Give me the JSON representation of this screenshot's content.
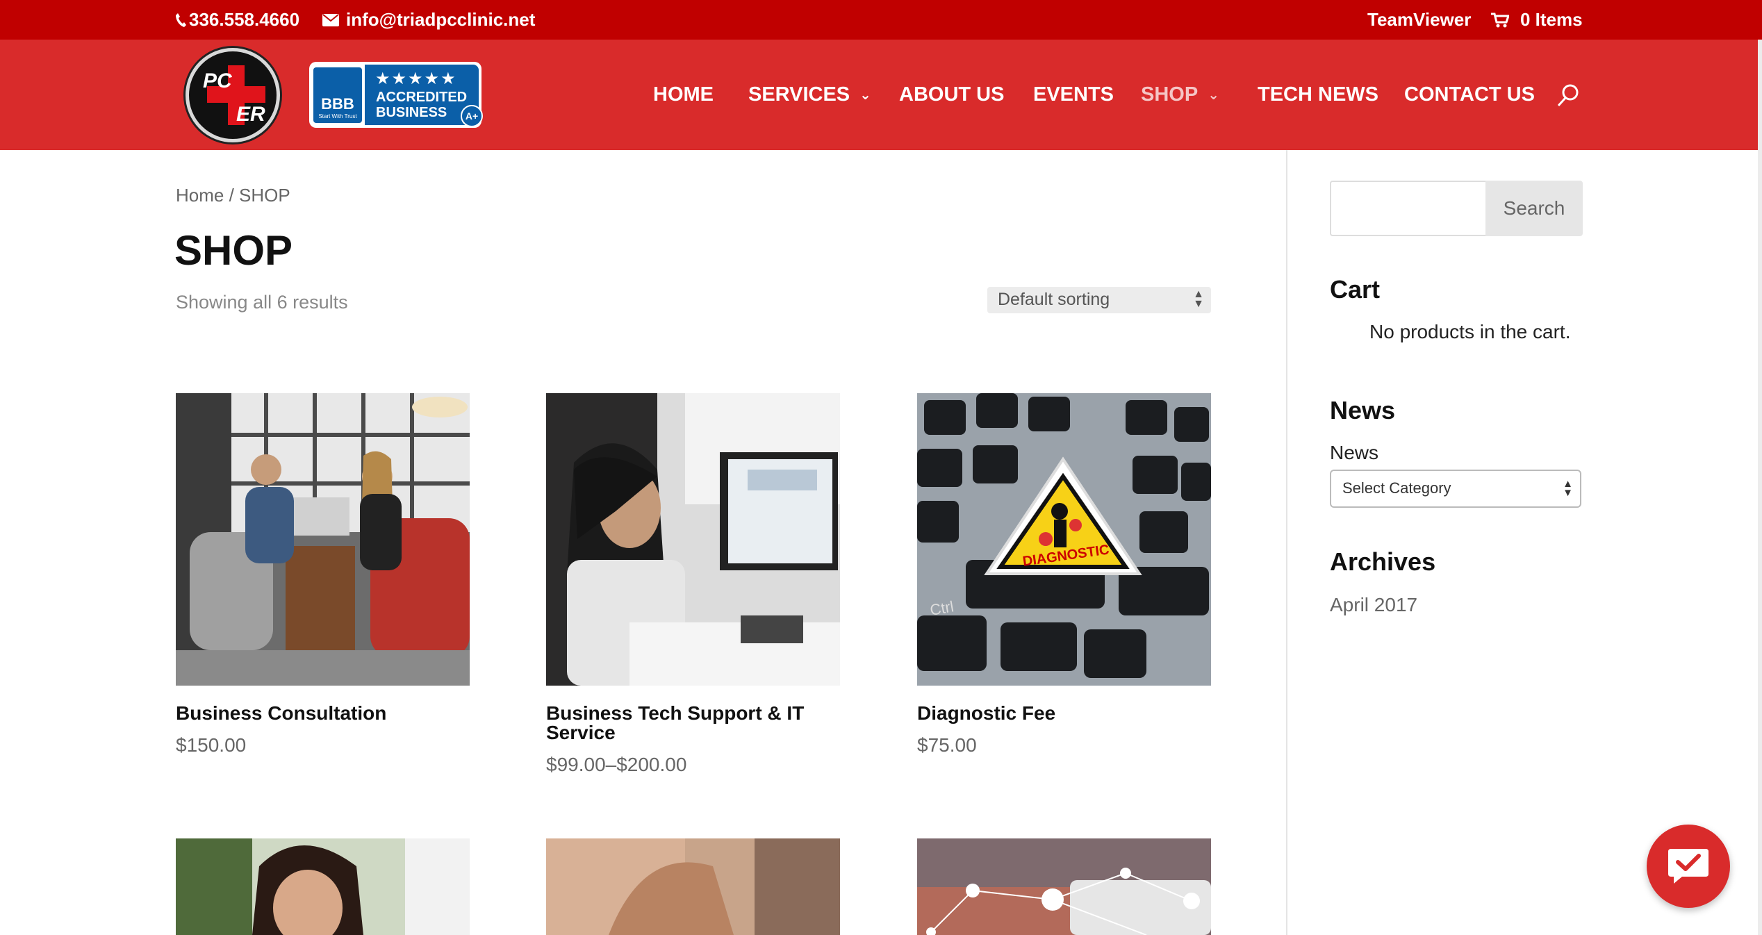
{
  "topbar": {
    "phone": "336.558.4660",
    "email": "info@triadpcclinic.net",
    "teamviewer": "TeamViewer",
    "cart": "0 Items"
  },
  "logo": {
    "pc": "PC",
    "er": "ER"
  },
  "bbb": {
    "letters": "BBB",
    "tagline": "Start With Trust",
    "stars": "★★★★★",
    "line1": "ACCREDITED",
    "line2": "BUSINESS",
    "grade": "A+"
  },
  "nav": {
    "items": [
      {
        "label": "HOME"
      },
      {
        "label": "SERVICES"
      },
      {
        "label": "ABOUT US"
      },
      {
        "label": "EVENTS"
      },
      {
        "label": "SHOP"
      },
      {
        "label": "TECH NEWS"
      },
      {
        "label": "CONTACT US"
      }
    ],
    "search_icon": "search-icon"
  },
  "breadcrumb": {
    "home": "Home",
    "separator": " / ",
    "current": "SHOP"
  },
  "page": {
    "title": "SHOP",
    "result_count": "Showing all 6 results",
    "sorting": "Default sorting"
  },
  "products": [
    {
      "name": "Business Consultation",
      "price": "$150.00"
    },
    {
      "name": "Business Tech Support & IT Service",
      "price": "$99.00–$200.00"
    },
    {
      "name": "Diagnostic Fee",
      "price": "$75.00"
    }
  ],
  "diagnostic_sign": "DIAGNOSTIC",
  "keyboard_key": "Ctrl",
  "sidebar": {
    "search_placeholder": "",
    "search_button": "Search",
    "cart_title": "Cart",
    "cart_empty": "No products in the cart.",
    "news_title": "News",
    "news_label": "News",
    "category_select": "Select Category",
    "archives_title": "Archives",
    "archive_item": "April 2017"
  },
  "colors": {
    "topbar": "#c00000",
    "header": "#d92b2b",
    "active_nav": "#f5c5c5"
  }
}
